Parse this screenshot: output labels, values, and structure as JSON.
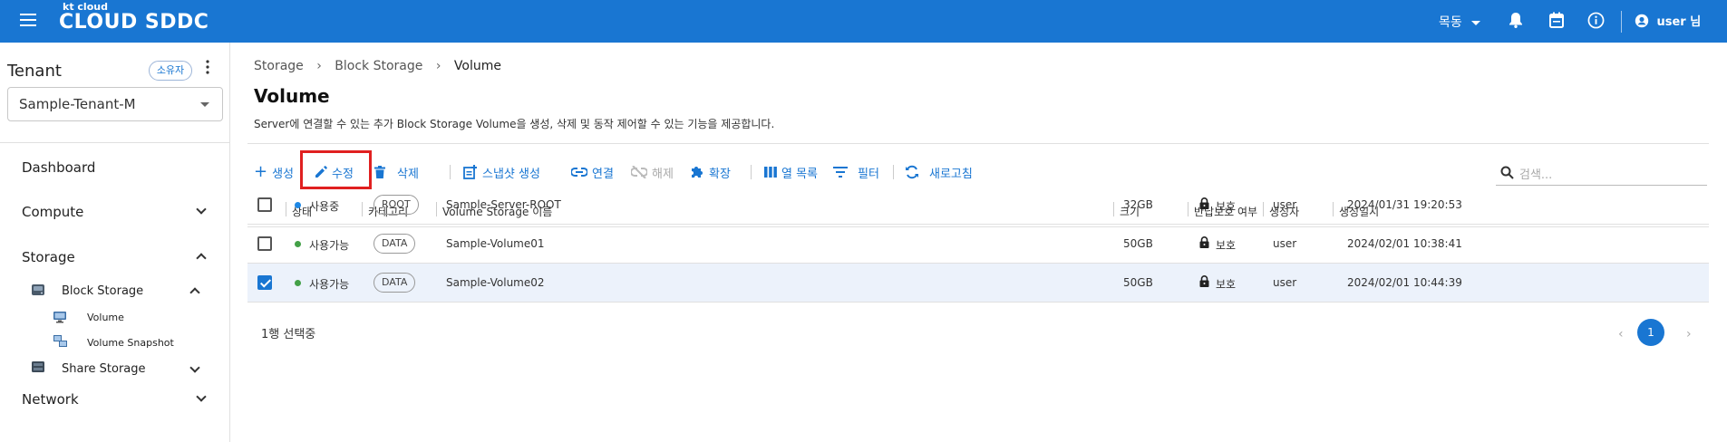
{
  "header": {
    "logo_small": "kt cloud",
    "logo_main": "CLOUD SDDC",
    "region_label": "목동",
    "user_label": "user 님",
    "brand_color": "#1976d2"
  },
  "sidebar": {
    "tenant_title": "Tenant",
    "owner_badge": "소유자",
    "tenant_value": "Sample-Tenant-M",
    "nav": {
      "dashboard": "Dashboard",
      "compute": "Compute",
      "storage": "Storage",
      "block_storage": "Block Storage",
      "volume": "Volume",
      "volume_snapshot": "Volume Snapshot",
      "share_storage": "Share Storage",
      "network": "Network"
    }
  },
  "main": {
    "breadcrumb": [
      "Storage",
      "Block Storage",
      "Volume"
    ],
    "title": "Volume",
    "description": "Server에 연결할 수 있는 추가 Block Storage Volume을 생성, 삭제 및 동작 제어할 수 있는 기능을 제공합니다.",
    "toolbar": {
      "create": "생성",
      "edit": "수정",
      "delete": "삭제",
      "snapshot": "스냅샷 생성",
      "connect": "연결",
      "disconnect": "해제",
      "extend": "확장",
      "columns": "열 목록",
      "filter": "필터",
      "refresh": "새로고침"
    },
    "search_placeholder": "검색...",
    "columns": [
      "상태",
      "카테고리",
      "Volume Storage 이름",
      "크기",
      "반납보호 여부",
      "생성자",
      "생성일시"
    ],
    "rows": [
      {
        "status": "사용중",
        "status_color": "#1e88e5",
        "category": "ROOT",
        "name": "Sample-Server-ROOT",
        "size": "32GB",
        "protect": "보호",
        "creator": "user",
        "created": "2024/01/31 19:20:53",
        "checked": false
      },
      {
        "status": "사용가능",
        "status_color": "#43a047",
        "category": "DATA",
        "name": "Sample-Volume01",
        "size": "50GB",
        "protect": "보호",
        "creator": "user",
        "created": "2024/02/01 10:38:41",
        "checked": false
      },
      {
        "status": "사용가능",
        "status_color": "#43a047",
        "category": "DATA",
        "name": "Sample-Volume02",
        "size": "50GB",
        "protect": "보호",
        "creator": "user",
        "created": "2024/02/01 10:44:39",
        "checked": true
      }
    ],
    "selection_text": "1행 선택중",
    "current_page": "1"
  }
}
